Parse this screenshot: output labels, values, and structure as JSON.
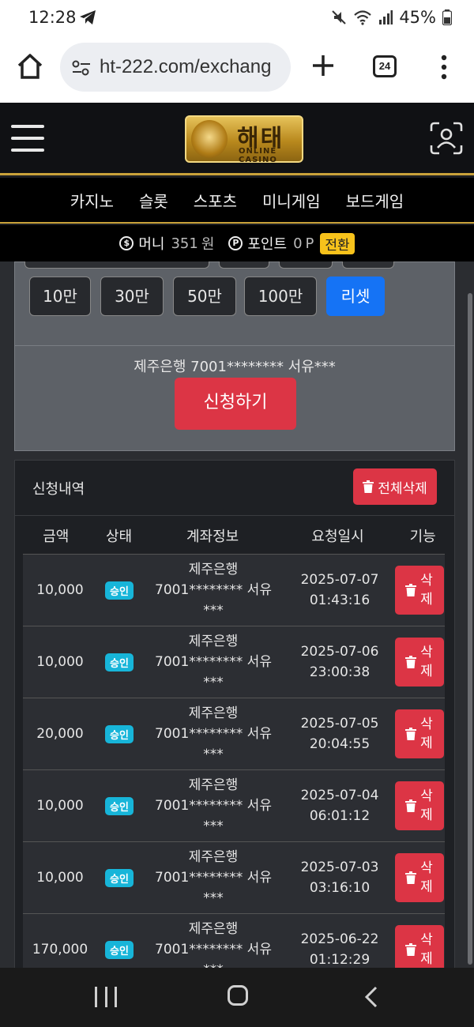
{
  "status": {
    "time": "12:28",
    "battery": "45%"
  },
  "browser": {
    "url": "ht-222.com/exchang",
    "tab_count": "24"
  },
  "brand": {
    "logo_ko": "해태",
    "logo_en": "ONLINE CASINO"
  },
  "nav": {
    "items": [
      "카지노",
      "슬롯",
      "스포츠",
      "미니게임",
      "보드게임"
    ]
  },
  "wallet": {
    "money_label": "머니",
    "money_value": "351",
    "money_unit": "원",
    "point_label": "포인트",
    "point_value": "0",
    "point_unit": "P",
    "convert_label": "전환"
  },
  "form": {
    "amount_buttons": [
      "10만",
      "30만",
      "50만",
      "100만"
    ],
    "reset_label": "리셋",
    "account_info": "제주은행 7001******** 서유***",
    "apply_label": "신청하기"
  },
  "history": {
    "title": "신청내역",
    "delete_all_label": "전체삭제",
    "columns": [
      "금액",
      "상태",
      "계좌정보",
      "요청일시",
      "기능"
    ],
    "delete_label": "삭제",
    "rows": [
      {
        "amount": "10,000",
        "status": "승인",
        "bank": "제주은행",
        "account": "7001******** 서유",
        "holder_tail": "***",
        "date": "2025-07-07",
        "time": "01:43:16"
      },
      {
        "amount": "10,000",
        "status": "승인",
        "bank": "제주은행",
        "account": "7001******** 서유",
        "holder_tail": "***",
        "date": "2025-07-06",
        "time": "23:00:38"
      },
      {
        "amount": "20,000",
        "status": "승인",
        "bank": "제주은행",
        "account": "7001******** 서유",
        "holder_tail": "***",
        "date": "2025-07-05",
        "time": "20:04:55"
      },
      {
        "amount": "10,000",
        "status": "승인",
        "bank": "제주은행",
        "account": "7001******** 서유",
        "holder_tail": "***",
        "date": "2025-07-04",
        "time": "06:01:12"
      },
      {
        "amount": "10,000",
        "status": "승인",
        "bank": "제주은행",
        "account": "7001******** 서유",
        "holder_tail": "***",
        "date": "2025-07-03",
        "time": "03:16:10"
      },
      {
        "amount": "170,000",
        "status": "승인",
        "bank": "제주은행",
        "account": "7001******** 서유",
        "holder_tail": "***",
        "date": "2025-06-22",
        "time": "01:12:29"
      }
    ]
  },
  "colors": {
    "accent_gold": "#c9a23a",
    "danger": "#dc3545",
    "primary": "#1573f5",
    "badge": "#17b5d9",
    "point_badge": "#f7c21b"
  }
}
